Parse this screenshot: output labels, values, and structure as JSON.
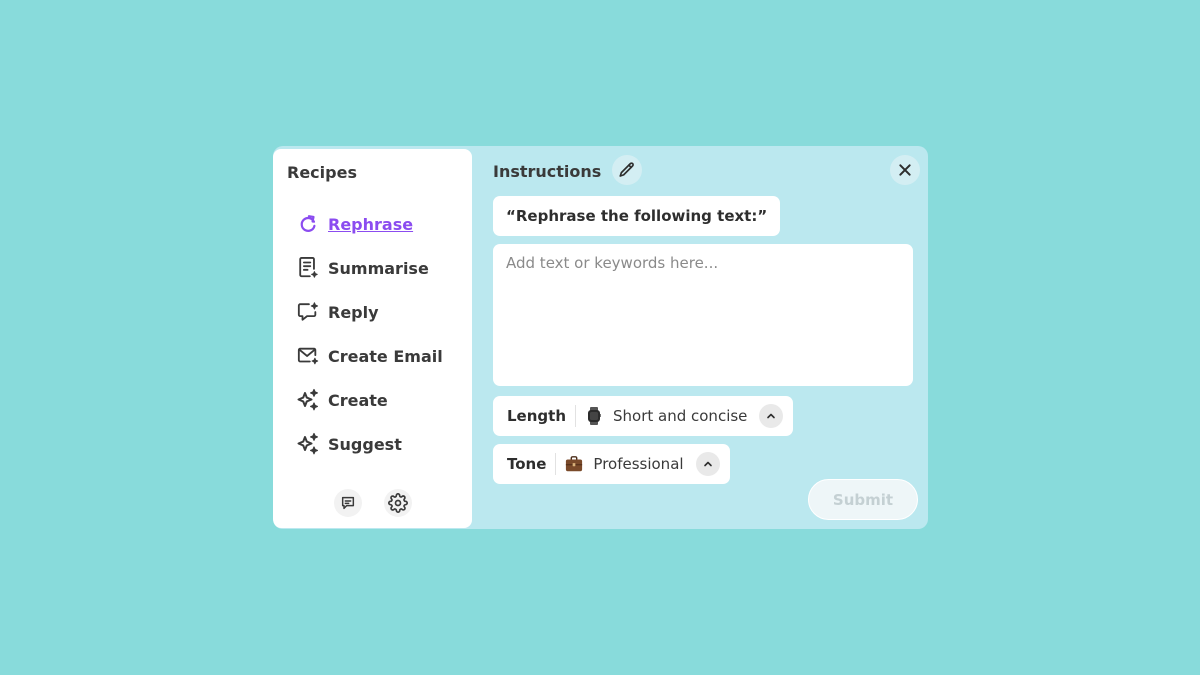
{
  "sidebar": {
    "title": "Recipes",
    "items": [
      {
        "label": "Rephrase",
        "icon": "rephrase-icon",
        "active": true
      },
      {
        "label": "Summarise",
        "icon": "document-icon"
      },
      {
        "label": "Reply",
        "icon": "reply-icon"
      },
      {
        "label": "Create Email",
        "icon": "email-icon"
      },
      {
        "label": "Create",
        "icon": "sparkle-icon"
      },
      {
        "label": "Suggest",
        "icon": "sparkle-icon"
      }
    ],
    "footer_icons": [
      "feedback-icon",
      "gear-icon"
    ]
  },
  "main": {
    "title": "Instructions",
    "prompt": "“Rephrase the following text:”",
    "input_placeholder": "Add text or keywords here...",
    "input_value": "",
    "options": [
      {
        "label": "Length",
        "value": "Short and concise",
        "icon": "watch-icon"
      },
      {
        "label": "Tone",
        "value": "Professional",
        "icon": "briefcase-icon"
      }
    ],
    "submit_label": "Submit"
  },
  "colors": {
    "background": "#88dbdb",
    "panel": "#bbe8ef",
    "accent": "#8b4cf0",
    "text": "#3a3a3a"
  }
}
